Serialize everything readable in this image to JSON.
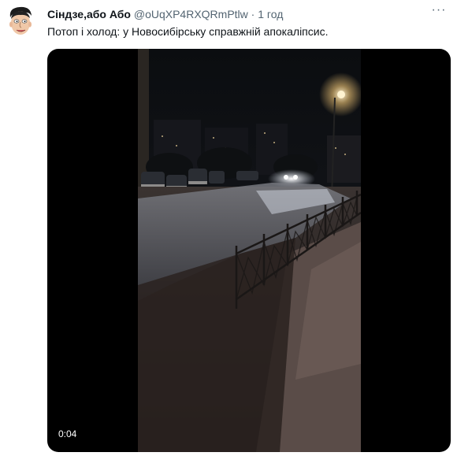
{
  "tweet": {
    "author_name": "Сіндзе,або Або",
    "author_handle": "@oUqXP4RXQRmPtlw",
    "separator": "·",
    "time": "1 год",
    "text": "Потоп і холод: у Новосибірську справжній апокаліпсис.",
    "more_icon": "···",
    "avatar_icon": "cartoon-face-avatar"
  },
  "video": {
    "duration": "0:04",
    "thumbnail": "flooded-street-night"
  }
}
